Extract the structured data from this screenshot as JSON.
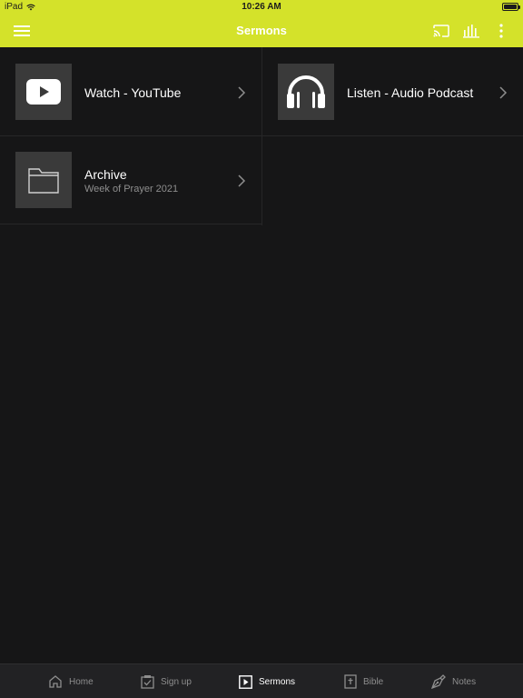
{
  "status_bar": {
    "device": "iPad",
    "time": "10:26 AM"
  },
  "nav": {
    "title": "Sermons",
    "icons": [
      "menu-icon",
      "cast-icon",
      "equalizer-icon",
      "more-vertical-icon"
    ]
  },
  "tiles": [
    {
      "title": "Watch - YouTube",
      "icon": "youtube-play-icon"
    },
    {
      "title": "Listen - Audio Podcast",
      "icon": "headphones-icon"
    },
    {
      "title": "Archive",
      "subtitle": "Week of Prayer 2021",
      "icon": "folder-icon"
    }
  ],
  "tab_bar": {
    "active": "Sermons",
    "tabs": [
      {
        "label": "Home",
        "icon": "home-icon"
      },
      {
        "label": "Sign up",
        "icon": "checkbox-icon"
      },
      {
        "label": "Sermons",
        "icon": "play-square-icon"
      },
      {
        "label": "Bible",
        "icon": "bible-icon"
      },
      {
        "label": "Notes",
        "icon": "pen-nib-icon"
      }
    ]
  },
  "colors": {
    "accent": "#d4e22a",
    "background": "#161617",
    "tile_thumb": "#3a3a3a",
    "tab_bar": "#222224"
  }
}
